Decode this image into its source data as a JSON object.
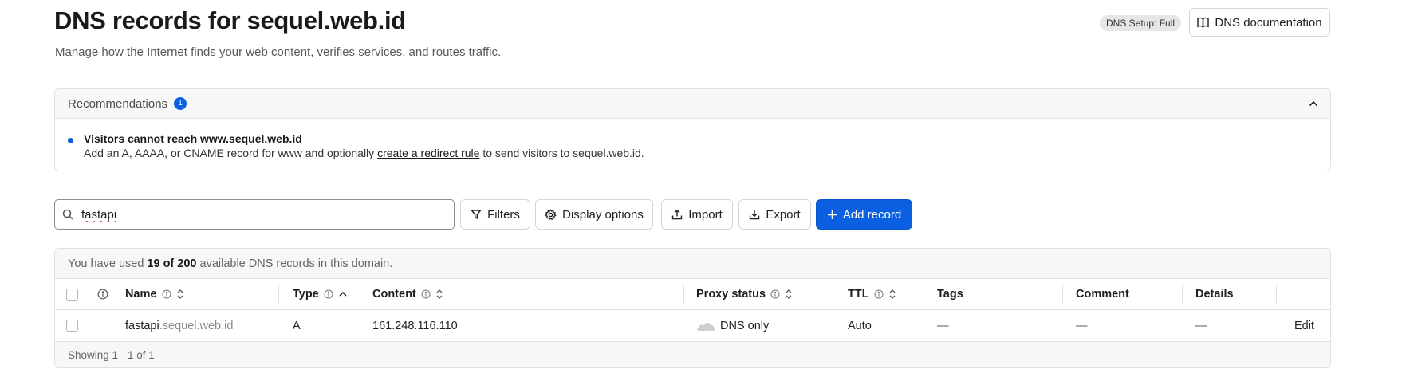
{
  "header": {
    "title": "DNS records for sequel.web.id",
    "subtitle": "Manage how the Internet finds your web content, verifies services, and routes traffic.",
    "setup_badge": "DNS Setup: Full",
    "docs_button": "DNS documentation"
  },
  "recommendations": {
    "label": "Recommendations",
    "count": "1",
    "items": [
      {
        "title": "Visitors cannot reach www.sequel.web.id",
        "desc_prefix": "Add an A, AAAA, or CNAME record for www and optionally ",
        "link": "create a redirect rule",
        "desc_suffix": " to send visitors to sequel.web.id."
      }
    ]
  },
  "toolbar": {
    "search_value": "fastapi",
    "filters": "Filters",
    "display_options": "Display options",
    "import": "Import",
    "export": "Export",
    "add_record": "Add record"
  },
  "table": {
    "usage_prefix": "You have used",
    "usage_count": "19 of 200",
    "usage_suffix": "available DNS records in this domain.",
    "columns": {
      "name": "Name",
      "type": "Type",
      "content": "Content",
      "proxy_status": "Proxy status",
      "ttl": "TTL",
      "tags": "Tags",
      "comment": "Comment",
      "details": "Details"
    },
    "rows": [
      {
        "name_match": "fastapi",
        "name_rest": ".sequel.web.id",
        "type": "A",
        "content": "161.248.116.110",
        "proxy_status": "DNS only",
        "ttl": "Auto",
        "tags": "—",
        "comment": "—",
        "details": "—",
        "action": "Edit"
      }
    ],
    "footer": "Showing 1 - 1 of 1"
  },
  "colors": {
    "accent": "#0a60e0",
    "border": "#e0e0e0",
    "muted_text": "#8a8a8a"
  }
}
